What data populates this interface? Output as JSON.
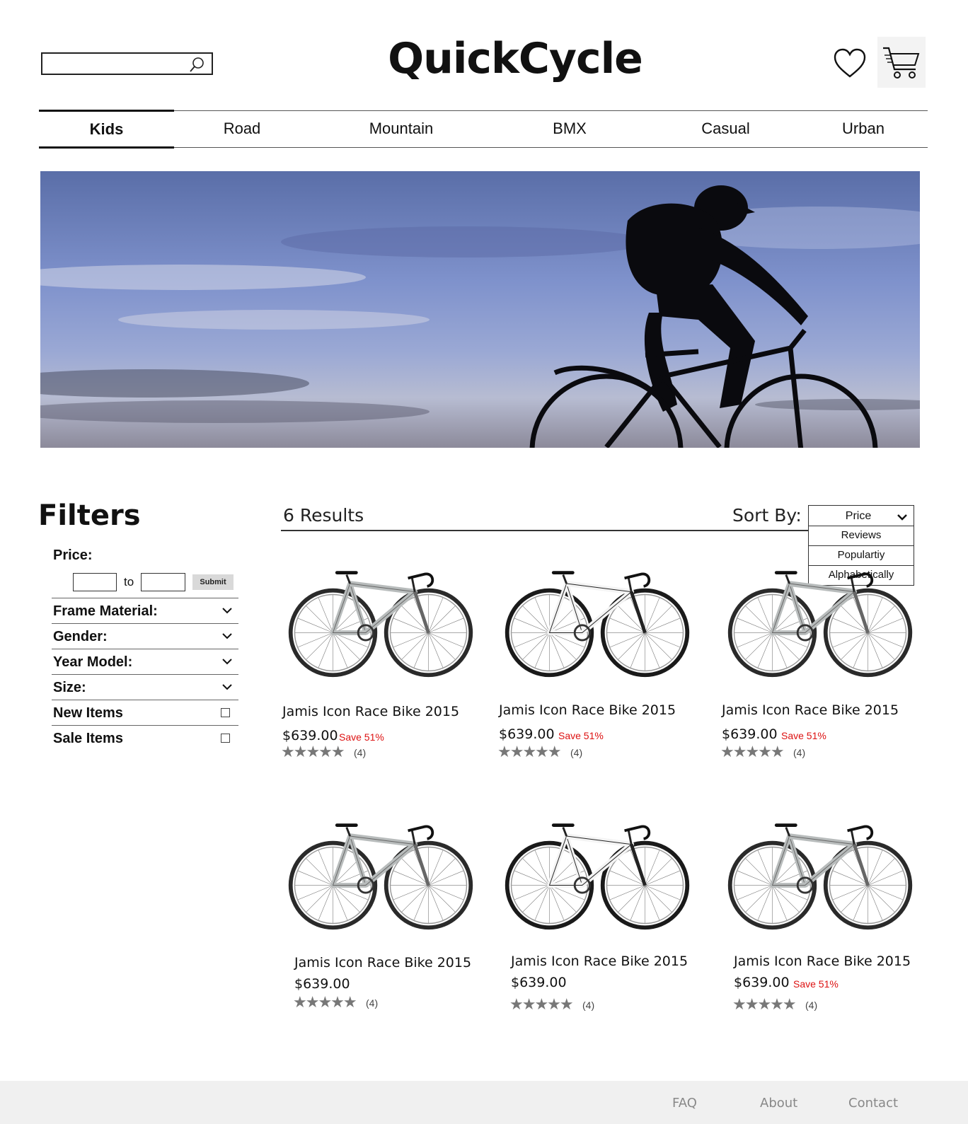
{
  "header": {
    "brand": "QuickCycle",
    "search": {
      "value": "",
      "placeholder": ""
    },
    "icons": {
      "search": "search-icon",
      "wishlist": "heart-icon",
      "cart": "cart-icon"
    }
  },
  "nav": {
    "tabs": [
      {
        "label": "Kids",
        "active": true
      },
      {
        "label": "Road",
        "active": false
      },
      {
        "label": "Mountain",
        "active": false
      },
      {
        "label": "BMX",
        "active": false
      },
      {
        "label": "Casual",
        "active": false
      },
      {
        "label": "Urban",
        "active": false
      }
    ]
  },
  "filters": {
    "title": "Filters",
    "price": {
      "label": "Price:",
      "to": "to",
      "min": "",
      "max": "",
      "submit": "Submit"
    },
    "rows": [
      {
        "label": "Frame Material:",
        "control": "chevron"
      },
      {
        "label": "Gender:",
        "control": "chevron"
      },
      {
        "label": "Year Model:",
        "control": "chevron"
      },
      {
        "label": "Size:",
        "control": "chevron"
      },
      {
        "label": "New Items",
        "control": "checkbox",
        "checked": false
      },
      {
        "label": "Sale Items",
        "control": "checkbox",
        "checked": false
      }
    ]
  },
  "results": {
    "count_label": "6 Results",
    "sort": {
      "label": "Sort By:",
      "selected": "Price",
      "options": [
        "Reviews",
        "Populartiy",
        "Alphabetically"
      ]
    }
  },
  "products": [
    {
      "name": "Jamis Icon Race Bike 2015",
      "price": "$639.00",
      "save": "Save 51%",
      "stars": "★★★★★",
      "rating": 5,
      "reviews": "(4)",
      "bike_style": "grey"
    },
    {
      "name": "Jamis Icon Race Bike 2015",
      "price": "$639.00",
      "save": "Save 51%",
      "stars": "★★★★★",
      "rating": 5,
      "reviews": "(4)",
      "bike_style": "white"
    },
    {
      "name": "Jamis Icon Race Bike 2015",
      "price": "$639.00",
      "save": "Save 51%",
      "stars": "★★★★★",
      "rating": 5,
      "reviews": "(4)",
      "bike_style": "grey"
    },
    {
      "name": "Jamis Icon Race Bike 2015",
      "price": "$639.00",
      "save": "",
      "stars": "★★★★★",
      "rating": 5,
      "reviews": "(4)",
      "bike_style": "grey"
    },
    {
      "name": "Jamis Icon Race Bike 2015",
      "price": "$639.00",
      "save": "",
      "stars": "★★★★★",
      "rating": 5,
      "reviews": "(4)",
      "bike_style": "white"
    },
    {
      "name": "Jamis Icon Race Bike 2015",
      "price": "$639.00",
      "save": "Save 51%",
      "stars": "★★★★★",
      "rating": 5,
      "reviews": "(4)",
      "bike_style": "grey"
    }
  ],
  "footer": {
    "links": [
      "FAQ",
      "About",
      "Contact"
    ]
  },
  "colors": {
    "sale": "#dd1111",
    "stars": "#777777",
    "footer_bg": "#f0f0f0",
    "footer_text": "#888888"
  }
}
